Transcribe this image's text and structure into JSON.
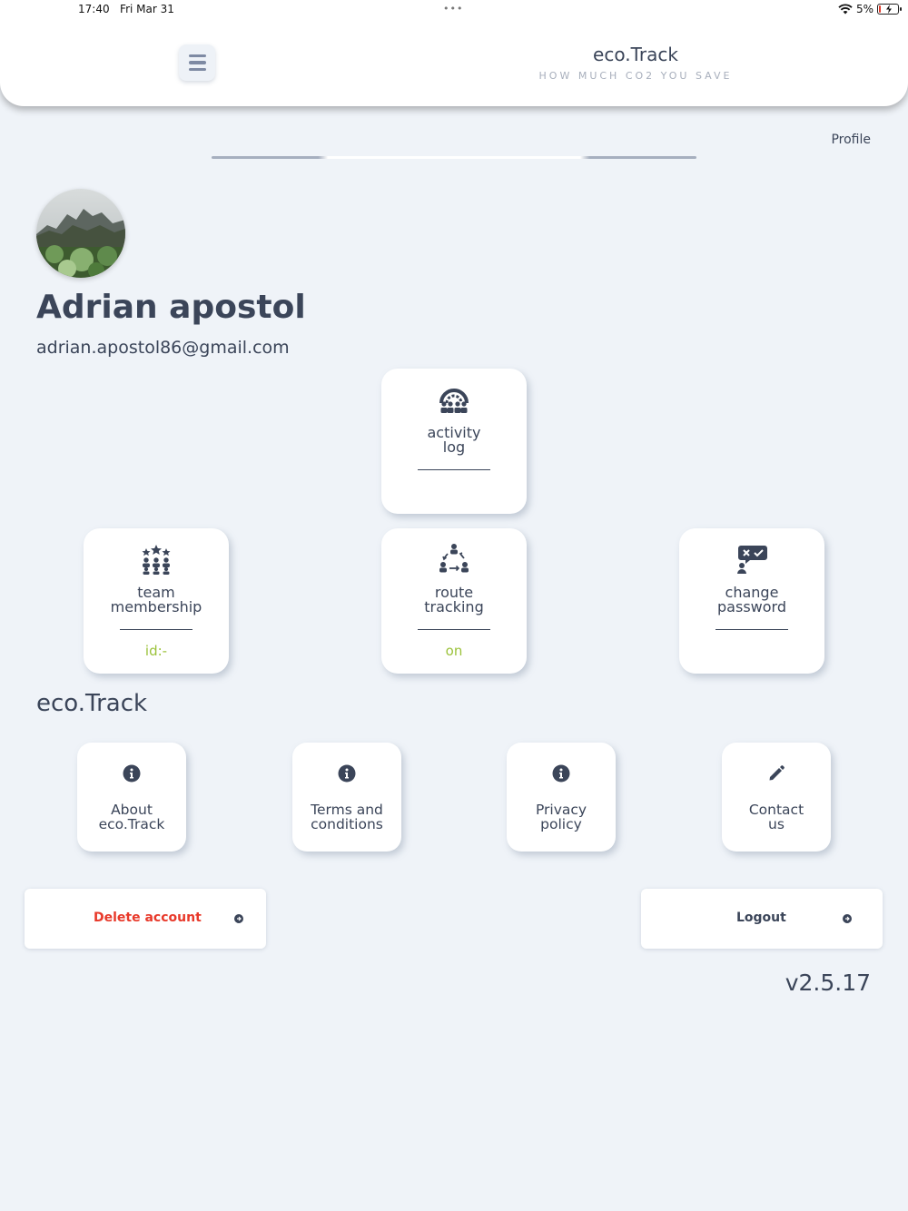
{
  "status_bar": {
    "time": "17:40",
    "date": "Fri Mar 31",
    "battery": "5%",
    "battery_level": 0.05
  },
  "header": {
    "menu_icon": "hamburger-menu-icon",
    "title": "eco.Track",
    "subtitle": "HOW MUCH CO2 YOU SAVE"
  },
  "page": {
    "label": "Profile"
  },
  "user": {
    "name": "Adrian apostol",
    "email": "adrian.apostol86@gmail.com"
  },
  "profile_cards": {
    "activity_log": {
      "label": "activity\nlog",
      "icon": "activity-log-icon"
    },
    "team_membership": {
      "label": "team\nmembership",
      "value": "id:-",
      "icon": "team-icon"
    },
    "route_tracking": {
      "label": "route\ntracking",
      "value": "on",
      "icon": "route-tracking-icon"
    },
    "change_password": {
      "label": "change\npassword",
      "icon": "password-chat-icon"
    }
  },
  "section": {
    "title": "eco.Track"
  },
  "info_cards": {
    "about": {
      "label": "About\neco.Track",
      "icon": "info-icon"
    },
    "terms": {
      "label": "Terms and\nconditions",
      "icon": "info-icon"
    },
    "privacy": {
      "label": "Privacy\npolicy",
      "icon": "info-icon"
    },
    "contact": {
      "label": "Contact\nus",
      "icon": "pencil-icon"
    }
  },
  "buttons": {
    "delete_account": "Delete account",
    "logout": "Logout"
  },
  "version": "v2.5.17",
  "colors": {
    "text": "#3b4559",
    "accent_green": "#9bc23a",
    "danger": "#e8392a",
    "background": "#eff3f8"
  }
}
